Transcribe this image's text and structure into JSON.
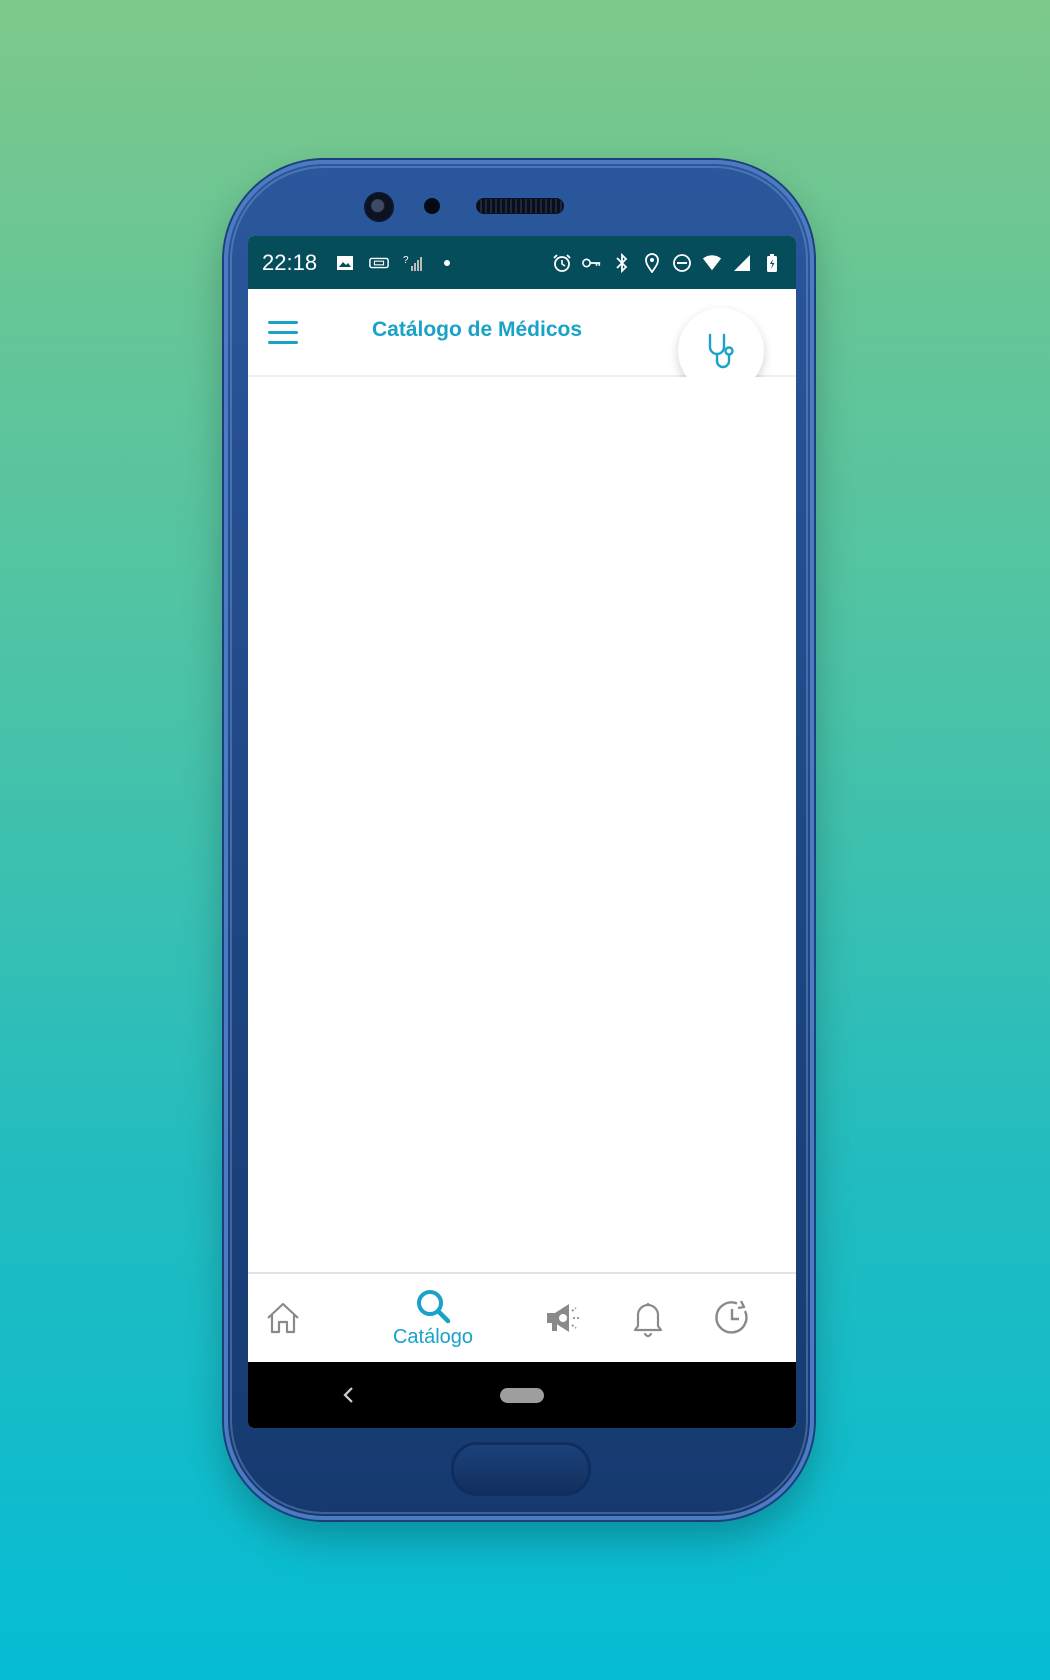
{
  "status_bar": {
    "time": "22:18",
    "left_icons": [
      "image-icon",
      "vpn-card-icon",
      "no-signal-icon",
      "dot-icon"
    ],
    "right_icons": [
      "alarm-icon",
      "key-icon",
      "bluetooth-icon",
      "location-icon",
      "do-not-disturb-icon",
      "wifi-icon",
      "signal-icon",
      "battery-charging-icon"
    ]
  },
  "app_bar": {
    "title": "Catálogo de Médicos",
    "menu_icon": "hamburger-menu-icon",
    "action_icon": "stethoscope-icon"
  },
  "fab": {
    "icon": "filter-icon"
  },
  "bottom_nav": {
    "items": [
      {
        "icon": "home-icon",
        "label": ""
      },
      {
        "icon": "search-icon",
        "label": "Catálogo",
        "active": true
      },
      {
        "icon": "megaphone-icon",
        "label": ""
      },
      {
        "icon": "bell-icon",
        "label": ""
      },
      {
        "icon": "history-icon",
        "label": ""
      }
    ]
  },
  "colors": {
    "accent": "#1aa2c7",
    "status_bar": "#054d5a",
    "fab": "#12a8c8",
    "inactive_icon": "#8a8a8a"
  }
}
